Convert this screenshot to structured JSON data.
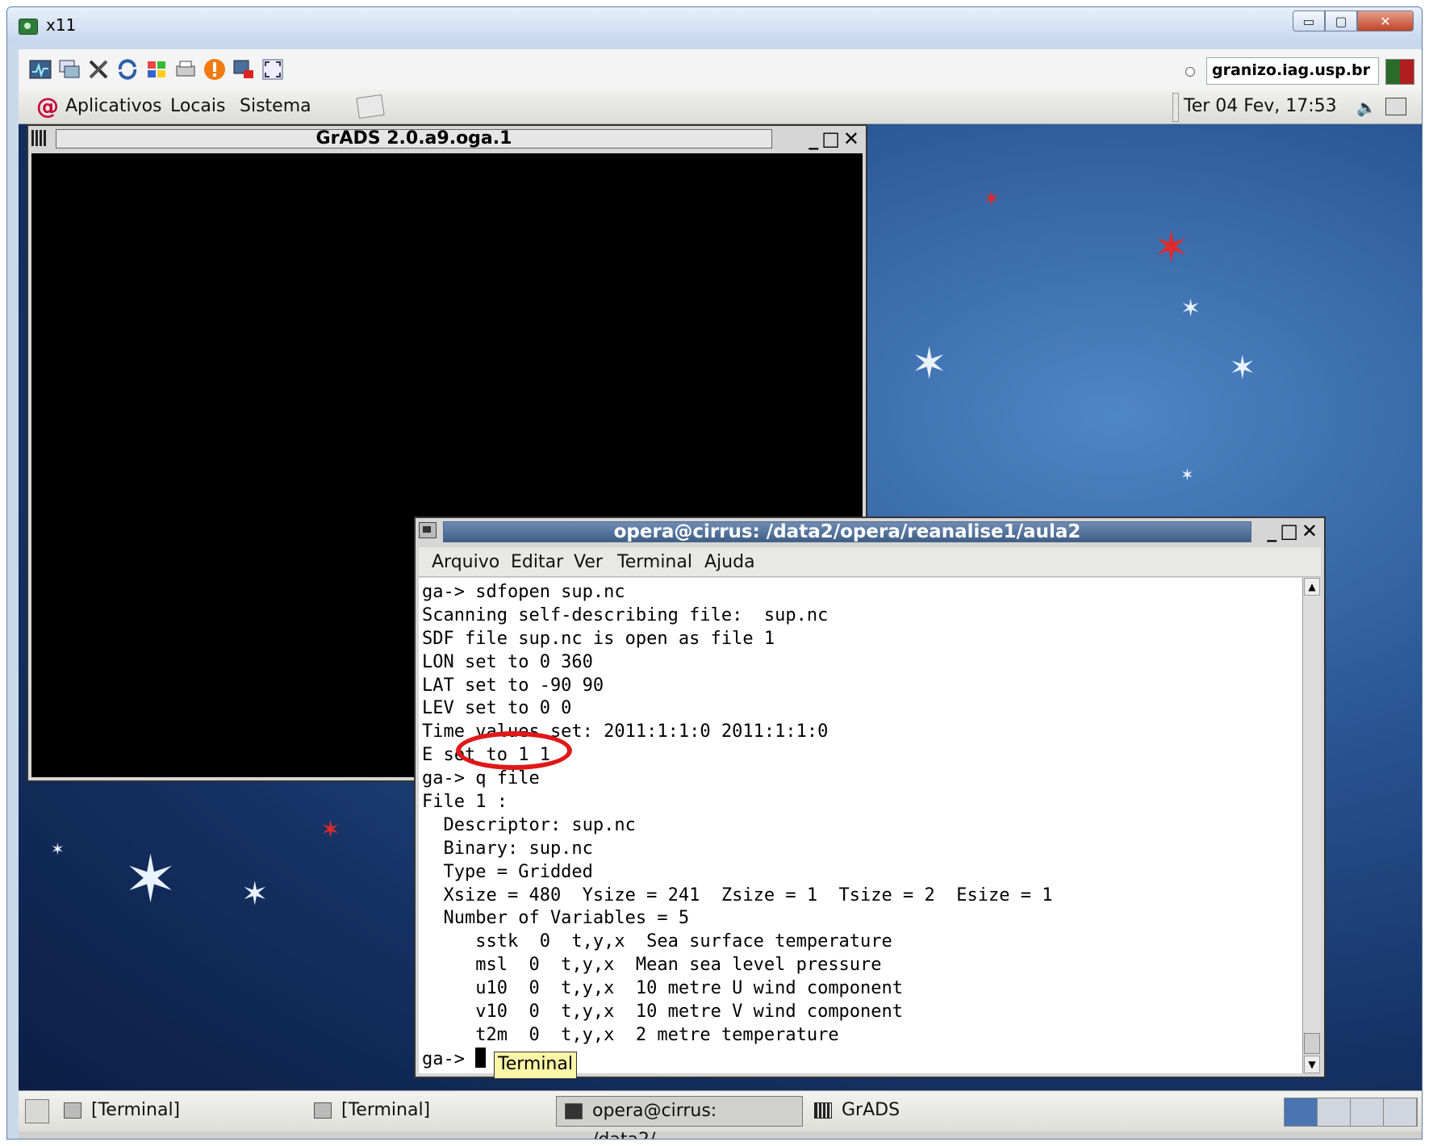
{
  "outer_window": {
    "title": "x11",
    "minimize_label": "▭",
    "maximize_label": "▢",
    "close_label": "✕"
  },
  "toolbar": {
    "host": "granizo.iag.usp.br"
  },
  "panel": {
    "menus": [
      "Aplicativos",
      "Locais",
      "Sistema"
    ],
    "clock": "Ter 04 Fev, 17:53"
  },
  "grads_window": {
    "title": "GrADS 2.0.a9.oga.1",
    "controls": "_□✕"
  },
  "terminal_window": {
    "title": "opera@cirrus: /data2/opera/reanalise1/aula2",
    "controls": "_□✕",
    "menu": [
      "Arquivo",
      "Editar",
      "Ver",
      "Terminal",
      "Ajuda"
    ],
    "lines": [
      "ga-> sdfopen sup.nc",
      "Scanning self-describing file:  sup.nc",
      "SDF file sup.nc is open as file 1",
      "LON set to 0 360",
      "LAT set to -90 90",
      "LEV set to 0 0",
      "Time values set: 2011:1:1:0 2011:1:1:0",
      "E set to 1 1",
      "ga-> q file",
      "File 1 :",
      "  Descriptor: sup.nc",
      "  Binary: sup.nc",
      "  Type = Gridded",
      "  Xsize = 480  Ysize = 241  Zsize = 1  Tsize = 2  Esize = 1",
      "  Number of Variables = 5",
      "     sstk  0  t,y,x  Sea surface temperature",
      "     msl  0  t,y,x  Mean sea level pressure",
      "     u10  0  t,y,x  10 metre U wind component",
      "     v10  0  t,y,x  10 metre V wind component",
      "     t2m  0  t,y,x  2 metre temperature"
    ],
    "prompt": "ga-> "
  },
  "taskbar": {
    "tasks": [
      "[Terminal]",
      "[Terminal]",
      "opera@cirrus: /data2/...",
      "GrADS"
    ],
    "tooltip": "Terminal"
  },
  "colors": {
    "annotation": "#e01818",
    "desktop": "#2a5795",
    "terminal_title": "#3f5f88"
  }
}
